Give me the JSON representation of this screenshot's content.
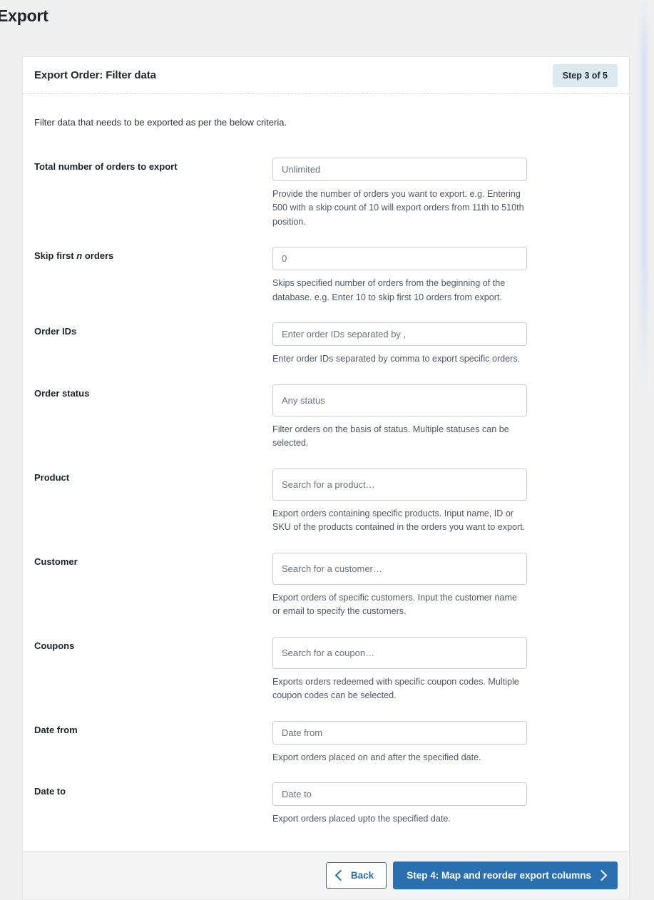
{
  "page": {
    "title": "Export"
  },
  "card": {
    "header": {
      "title": "Export Order: Filter data",
      "step_badge": "Step 3 of 5"
    },
    "intro": "Filter data that needs to be exported as per the below criteria.",
    "fields": [
      {
        "label_prefix": "Total number of orders to export",
        "label_em": "",
        "label_suffix": "",
        "control": "input",
        "placeholder": "Unlimited",
        "value": "",
        "description": "Provide the number of orders you want to export. e.g. Entering 500 with a skip count of 10 will export orders from 11th to 510th position."
      },
      {
        "label_prefix": "Skip first ",
        "label_em": "n",
        "label_suffix": " orders",
        "control": "input",
        "placeholder": "0",
        "value": "",
        "description": "Skips specified number of orders from the beginning of the database. e.g. Enter 10 to skip first 10 orders from export."
      },
      {
        "label_prefix": "Order IDs",
        "label_em": "",
        "label_suffix": "",
        "control": "input",
        "placeholder": "Enter order IDs separated by ,",
        "value": "",
        "description": "Enter order IDs separated by comma to export specific orders."
      },
      {
        "label_prefix": "Order status",
        "label_em": "",
        "label_suffix": "",
        "control": "select2",
        "placeholder": "Any status",
        "value": "",
        "description": "Filter orders on the basis of status. Multiple statuses can be selected."
      },
      {
        "label_prefix": "Product",
        "label_em": "",
        "label_suffix": "",
        "control": "select2",
        "placeholder": "Search for a product…",
        "value": "",
        "description": "Export orders containing specific products. Input name, ID or SKU of the products contained in the orders you want to export."
      },
      {
        "label_prefix": "Customer",
        "label_em": "",
        "label_suffix": "",
        "control": "select2",
        "placeholder": "Search for a customer…",
        "value": "",
        "description": "Export orders of specific customers. Input the customer name or email to specify the customers."
      },
      {
        "label_prefix": "Coupons",
        "label_em": "",
        "label_suffix": "",
        "control": "select2",
        "placeholder": "Search for a coupon…",
        "value": "",
        "description": "Exports orders redeemed with specific coupon codes. Multiple coupon codes can be selected."
      },
      {
        "label_prefix": "Date from",
        "label_em": "",
        "label_suffix": "",
        "control": "input",
        "placeholder": "Date from",
        "value": "",
        "description": "Export orders placed on and after the specified date."
      },
      {
        "label_prefix": "Date to",
        "label_em": "",
        "label_suffix": "",
        "control": "input",
        "placeholder": "Date to",
        "value": "",
        "description": "Export orders placed upto the specified date."
      }
    ],
    "footer": {
      "back_label": "Back",
      "next_label": "Step 4: Map and reorder export columns",
      "back_icon": "chevron-left-icon",
      "next_icon": "chevron-right-icon"
    }
  },
  "colors": {
    "page_background": "#f0f0f1",
    "card_background": "#ffffff",
    "badge_background": "#dbeaf1",
    "primary_button": "#2a6fb0",
    "link_blue": "#2271b1",
    "footer_background": "#f4f4f4",
    "input_border": "#c9ccd1",
    "placeholder_text": "#6b7177",
    "description_text": "#50575e"
  }
}
